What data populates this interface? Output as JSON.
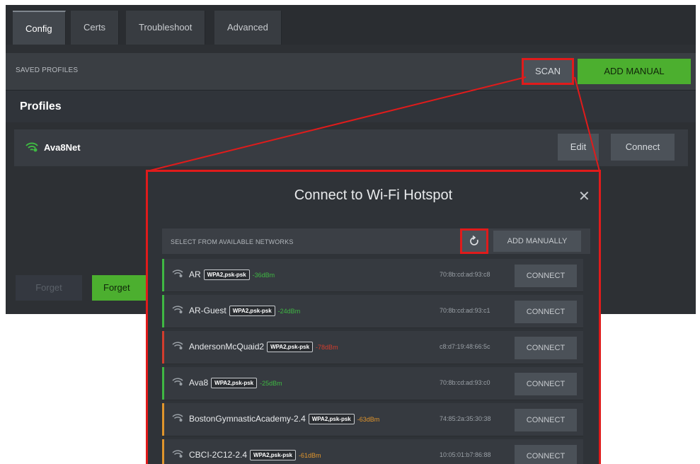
{
  "tabs": [
    {
      "label": "Config",
      "active": true
    },
    {
      "label": "Certs",
      "active": false
    },
    {
      "label": "Troubleshoot",
      "active": false
    },
    {
      "label": "Advanced",
      "active": false
    }
  ],
  "saved": {
    "label": "SAVED PROFILES",
    "scan_label": "SCAN",
    "add_manual_label": "ADD MANUAL"
  },
  "profiles": {
    "title": "Profiles",
    "items": [
      {
        "name": "Ava8Net",
        "icon": "wifi-icon",
        "edit_label": "Edit",
        "connect_label": "Connect"
      }
    ],
    "forget_disabled_label": "Forget",
    "forget_label": "Forget"
  },
  "dialog": {
    "title": "Connect to Wi-Fi Hotspot",
    "close_glyph": "✕",
    "available_label": "SELECT FROM AVAILABLE NETWORKS",
    "add_manually_label": "ADD MANUALLY",
    "networks": [
      {
        "name": "AR",
        "security": "WPA2,psk-psk",
        "signal": "-36dBm",
        "mac": "70:8b:cd:ad:93:c8",
        "connect_label": "CONNECT",
        "strength": "good"
      },
      {
        "name": "AR-Guest",
        "security": "WPA2,psk-psk",
        "signal": "-24dBm",
        "mac": "70:8b:cd:ad:93:c1",
        "connect_label": "CONNECT",
        "strength": "good"
      },
      {
        "name": "AndersonMcQuaid2",
        "security": "WPA2,psk-psk",
        "signal": "-78dBm",
        "mac": "c8:d7:19:48:66:5c",
        "connect_label": "CONNECT",
        "strength": "poor"
      },
      {
        "name": "Ava8",
        "security": "WPA2,psk-psk",
        "signal": "-25dBm",
        "mac": "70:8b:cd:ad:93:c0",
        "connect_label": "CONNECT",
        "strength": "good"
      },
      {
        "name": "BostonGymnasticAcademy-2.4",
        "security": "WPA2,psk-psk",
        "signal": "-63dBm",
        "mac": "74:85:2a:35:30:38",
        "connect_label": "CONNECT",
        "strength": "fair"
      },
      {
        "name": "CBCI-2C12-2.4",
        "security": "WPA2,psk-psk",
        "signal": "-61dBm",
        "mac": "10:05:01:b7:86:88",
        "connect_label": "CONNECT",
        "strength": "fair"
      }
    ]
  },
  "colors": {
    "good": "#3fb843",
    "fair": "#e0952c",
    "poor": "#d23d2e",
    "highlight": "#e01b1b",
    "accent_green": "#4caf2f"
  }
}
